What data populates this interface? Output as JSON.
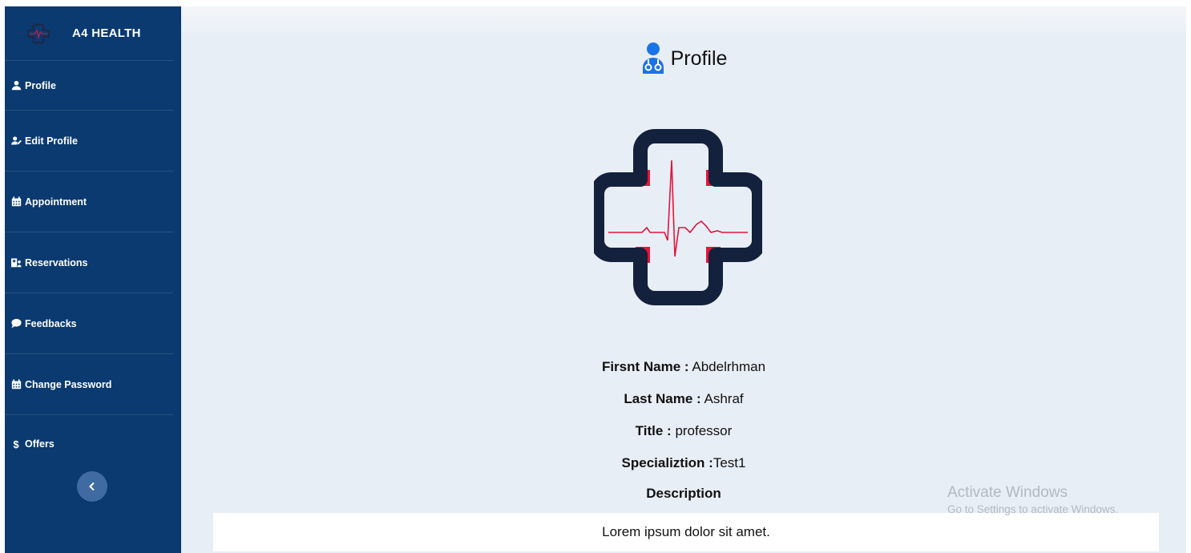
{
  "brand": {
    "name": "A4 HEALTH"
  },
  "sidebar": {
    "items": [
      {
        "label": "Profile",
        "icon": "user-icon"
      },
      {
        "label": "Edit Profile",
        "icon": "user-edit-icon"
      },
      {
        "label": "Appointment",
        "icon": "calendar-icon"
      },
      {
        "label": "Reservations",
        "icon": "hospital-user-icon"
      },
      {
        "label": "Feedbacks",
        "icon": "comment-icon"
      },
      {
        "label": "Change Password",
        "icon": "calendar-icon"
      },
      {
        "label": "Offers",
        "icon": "dollar-icon",
        "prefix": "$"
      }
    ],
    "collapse_icon": "chevron-left-icon"
  },
  "main": {
    "title": "Profile",
    "title_icon": "user-doctor-icon",
    "fields": {
      "first_name_label": "Firsnt Name :",
      "first_name_value": "Abdelrhman",
      "last_name_label": "Last Name :",
      "last_name_value": "Ashraf",
      "title_label": "Title :",
      "title_value": "professor",
      "specialization_label": "Specializtion :",
      "specialization_value": "Test1",
      "description_label": "Description",
      "description_value": "Lorem ipsum dolor sit amet."
    }
  },
  "watermark": {
    "line1": "Activate Windows",
    "line2": "Go to Settings to activate Windows."
  },
  "colors": {
    "sidebar_bg": "#0a3a70",
    "main_bg": "#e8eef6",
    "accent_red": "#e5143c",
    "logo_navy": "#14213d",
    "title_icon_blue": "#1a73e8"
  }
}
